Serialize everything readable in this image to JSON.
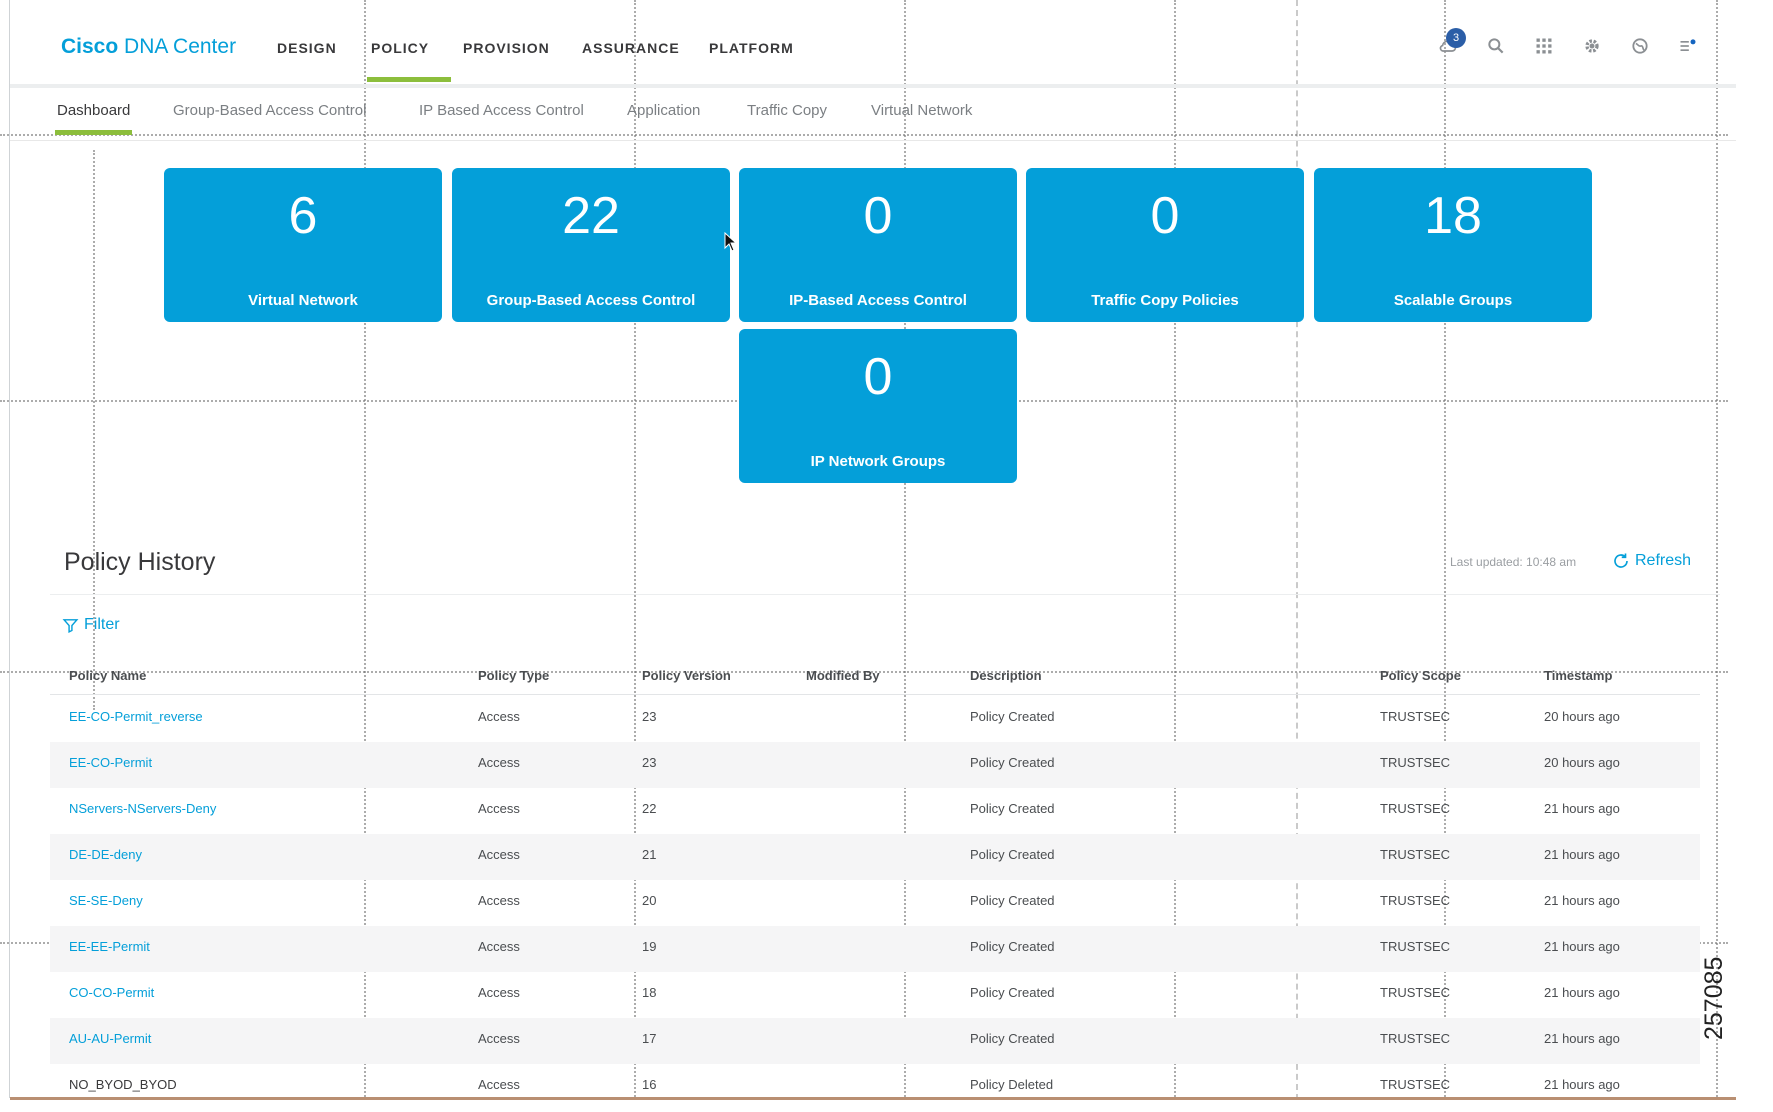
{
  "brand": {
    "strong": "Cisco",
    "light": " DNA Center"
  },
  "topnav": {
    "items": [
      {
        "label": "DESIGN",
        "active": false
      },
      {
        "label": "POLICY",
        "active": true
      },
      {
        "label": "PROVISION",
        "active": false
      },
      {
        "label": "ASSURANCE",
        "active": false
      },
      {
        "label": "PLATFORM",
        "active": false
      }
    ],
    "notification_count": "3",
    "icons": [
      "cloud-icon",
      "search-icon",
      "apps-grid-icon",
      "gear-icon",
      "globe-icon",
      "list-notification-icon"
    ]
  },
  "subtabs": [
    {
      "label": "Dashboard",
      "active": true
    },
    {
      "label": "Group-Based Access Control",
      "active": false
    },
    {
      "label": "IP Based Access Control",
      "active": false
    },
    {
      "label": "Application",
      "active": false
    },
    {
      "label": "Traffic Copy",
      "active": false
    },
    {
      "label": "Virtual Network",
      "active": false
    }
  ],
  "tiles": [
    {
      "count": "6",
      "label": "Virtual Network"
    },
    {
      "count": "22",
      "label": "Group-Based Access Control"
    },
    {
      "count": "0",
      "label": "IP-Based Access Control"
    },
    {
      "count": "0",
      "label": "Traffic Copy Policies"
    },
    {
      "count": "18",
      "label": "Scalable Groups"
    },
    {
      "count": "0",
      "label": "IP Network Groups"
    }
  ],
  "policy_history": {
    "title": "Policy History",
    "last_updated": "Last updated: 10:48 am",
    "refresh_label": "Refresh",
    "filter_label": "Filter",
    "columns": [
      "Policy Name",
      "Policy Type",
      "Policy Version",
      "Modified By",
      "Description",
      "Policy Scope",
      "Timestamp"
    ],
    "rows": [
      {
        "name": "EE-CO-Permit_reverse",
        "type": "Access",
        "version": "23",
        "modified_by": "",
        "description": "Policy Created",
        "scope": "TRUSTSEC",
        "timestamp": "20 hours ago",
        "link": true
      },
      {
        "name": "EE-CO-Permit",
        "type": "Access",
        "version": "23",
        "modified_by": "",
        "description": "Policy Created",
        "scope": "TRUSTSEC",
        "timestamp": "20 hours ago",
        "link": true
      },
      {
        "name": "NServers-NServers-Deny",
        "type": "Access",
        "version": "22",
        "modified_by": "",
        "description": "Policy Created",
        "scope": "TRUSTSEC",
        "timestamp": "21 hours ago",
        "link": true
      },
      {
        "name": "DE-DE-deny",
        "type": "Access",
        "version": "21",
        "modified_by": "",
        "description": "Policy Created",
        "scope": "TRUSTSEC",
        "timestamp": "21 hours ago",
        "link": true
      },
      {
        "name": "SE-SE-Deny",
        "type": "Access",
        "version": "20",
        "modified_by": "",
        "description": "Policy Created",
        "scope": "TRUSTSEC",
        "timestamp": "21 hours ago",
        "link": true
      },
      {
        "name": "EE-EE-Permit",
        "type": "Access",
        "version": "19",
        "modified_by": "",
        "description": "Policy Created",
        "scope": "TRUSTSEC",
        "timestamp": "21 hours ago",
        "link": true
      },
      {
        "name": "CO-CO-Permit",
        "type": "Access",
        "version": "18",
        "modified_by": "",
        "description": "Policy Created",
        "scope": "TRUSTSEC",
        "timestamp": "21 hours ago",
        "link": true
      },
      {
        "name": "AU-AU-Permit",
        "type": "Access",
        "version": "17",
        "modified_by": "",
        "description": "Policy Created",
        "scope": "TRUSTSEC",
        "timestamp": "21 hours ago",
        "link": true
      },
      {
        "name": "NO_BYOD_BYOD",
        "type": "Access",
        "version": "16",
        "modified_by": "",
        "description": "Policy Deleted",
        "scope": "TRUSTSEC",
        "timestamp": "21 hours ago",
        "link": false
      }
    ]
  },
  "figure_number": "257085",
  "colors": {
    "accent": "#049fd9",
    "active_underline": "#8cbe3c",
    "badge": "#2b5ea7"
  }
}
